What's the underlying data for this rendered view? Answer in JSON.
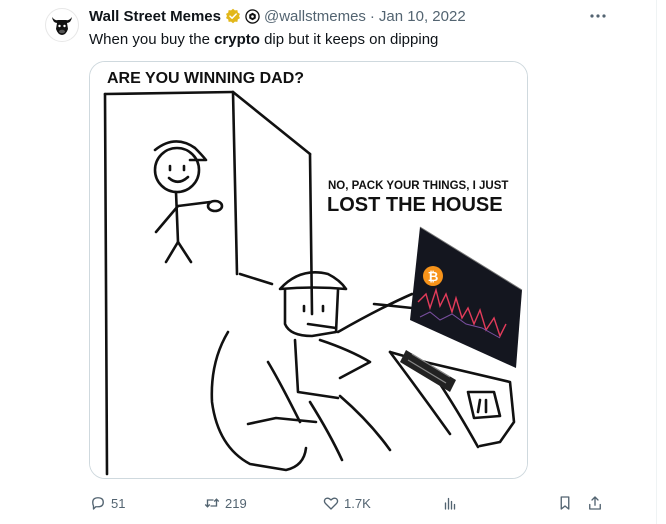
{
  "tweet": {
    "author_name": "Wall Street Memes",
    "handle": "@wallstmemes",
    "separator": "·",
    "date": "Jan 10, 2022",
    "text_before": "When you buy the ",
    "text_bold": "crypto",
    "text_after": " dip but it keeps on dipping",
    "more_icon": "more-dots-icon"
  },
  "meme": {
    "top_caption": "ARE YOU WINNING DAD?",
    "answer_small": "NO, PACK YOUR THINGS, I JUST",
    "answer_large": "LOST THE HOUSE",
    "coin_glyph": "₿",
    "chart_color": "#e23b5a",
    "coin_color": "#f7931a"
  },
  "actions": {
    "replies": "51",
    "retweets": "219",
    "likes": "1.7K"
  },
  "colors": {
    "secondary_text": "#536471",
    "verified_gold": "#e2b719",
    "border": "#cfd9de"
  }
}
